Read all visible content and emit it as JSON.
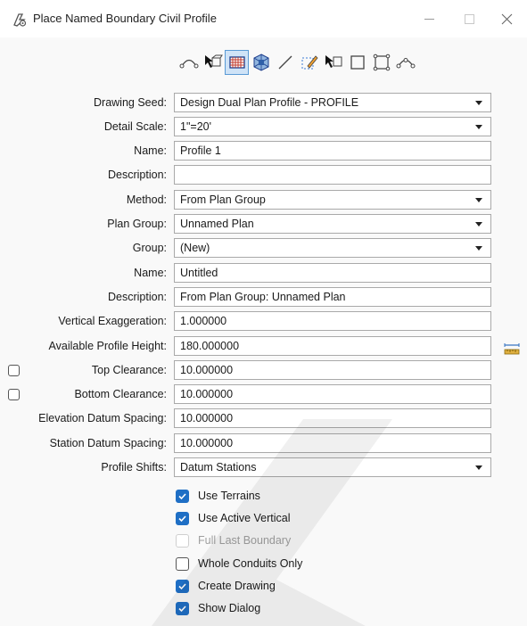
{
  "window": {
    "title": "Place Named Boundary Civil Profile"
  },
  "toolbar": {
    "tools": [
      "profile-by-curve-icon",
      "profile-by-shape-icon",
      "profile-grid-icon",
      "profile-3d-icon",
      "profile-by-line-icon",
      "profile-by-edit-icon",
      "profile-by-element-icon",
      "profile-by-rectangle-icon",
      "profile-by-polygon-icon",
      "profile-by-curve2-icon"
    ],
    "active_index": 2
  },
  "form": {
    "drawing_seed": {
      "label": "Drawing Seed:",
      "value": "Design Dual Plan Profile - PROFILE"
    },
    "detail_scale": {
      "label": "Detail Scale:",
      "value": "1\"=20'"
    },
    "name": {
      "label": "Name:",
      "value": "Profile 1"
    },
    "description": {
      "label": "Description:",
      "value": ""
    },
    "method": {
      "label": "Method:",
      "value": "From Plan Group"
    },
    "plan_group": {
      "label": "Plan Group:",
      "value": "Unnamed Plan"
    },
    "group": {
      "label": "Group:",
      "value": "(New)"
    },
    "group_name": {
      "label": "Name:",
      "value": "Untitled"
    },
    "group_description": {
      "label": "Description:",
      "value": "From Plan Group: Unnamed Plan"
    },
    "vertical_exaggeration": {
      "label": "Vertical Exaggeration:",
      "value": "1.000000"
    },
    "available_profile_height": {
      "label": "Available Profile Height:",
      "value": "180.000000"
    },
    "top_clearance": {
      "label": "Top Clearance:",
      "value": "10.000000",
      "checked": false
    },
    "bottom_clearance": {
      "label": "Bottom Clearance:",
      "value": "10.000000",
      "checked": false
    },
    "elevation_datum_spacing": {
      "label": "Elevation Datum Spacing:",
      "value": "10.000000"
    },
    "station_datum_spacing": {
      "label": "Station Datum Spacing:",
      "value": "10.000000"
    },
    "profile_shifts": {
      "label": "Profile Shifts:",
      "value": "Datum Stations"
    }
  },
  "checkboxes": [
    {
      "label": "Use Terrains",
      "state": "checked"
    },
    {
      "label": "Use Active Vertical",
      "state": "checked"
    },
    {
      "label": "Full Last Boundary",
      "state": "disabled"
    },
    {
      "label": "Whole Conduits Only",
      "state": "unchecked"
    },
    {
      "label": "Create Drawing",
      "state": "checked"
    },
    {
      "label": "Show Dialog",
      "state": "checked"
    }
  ]
}
